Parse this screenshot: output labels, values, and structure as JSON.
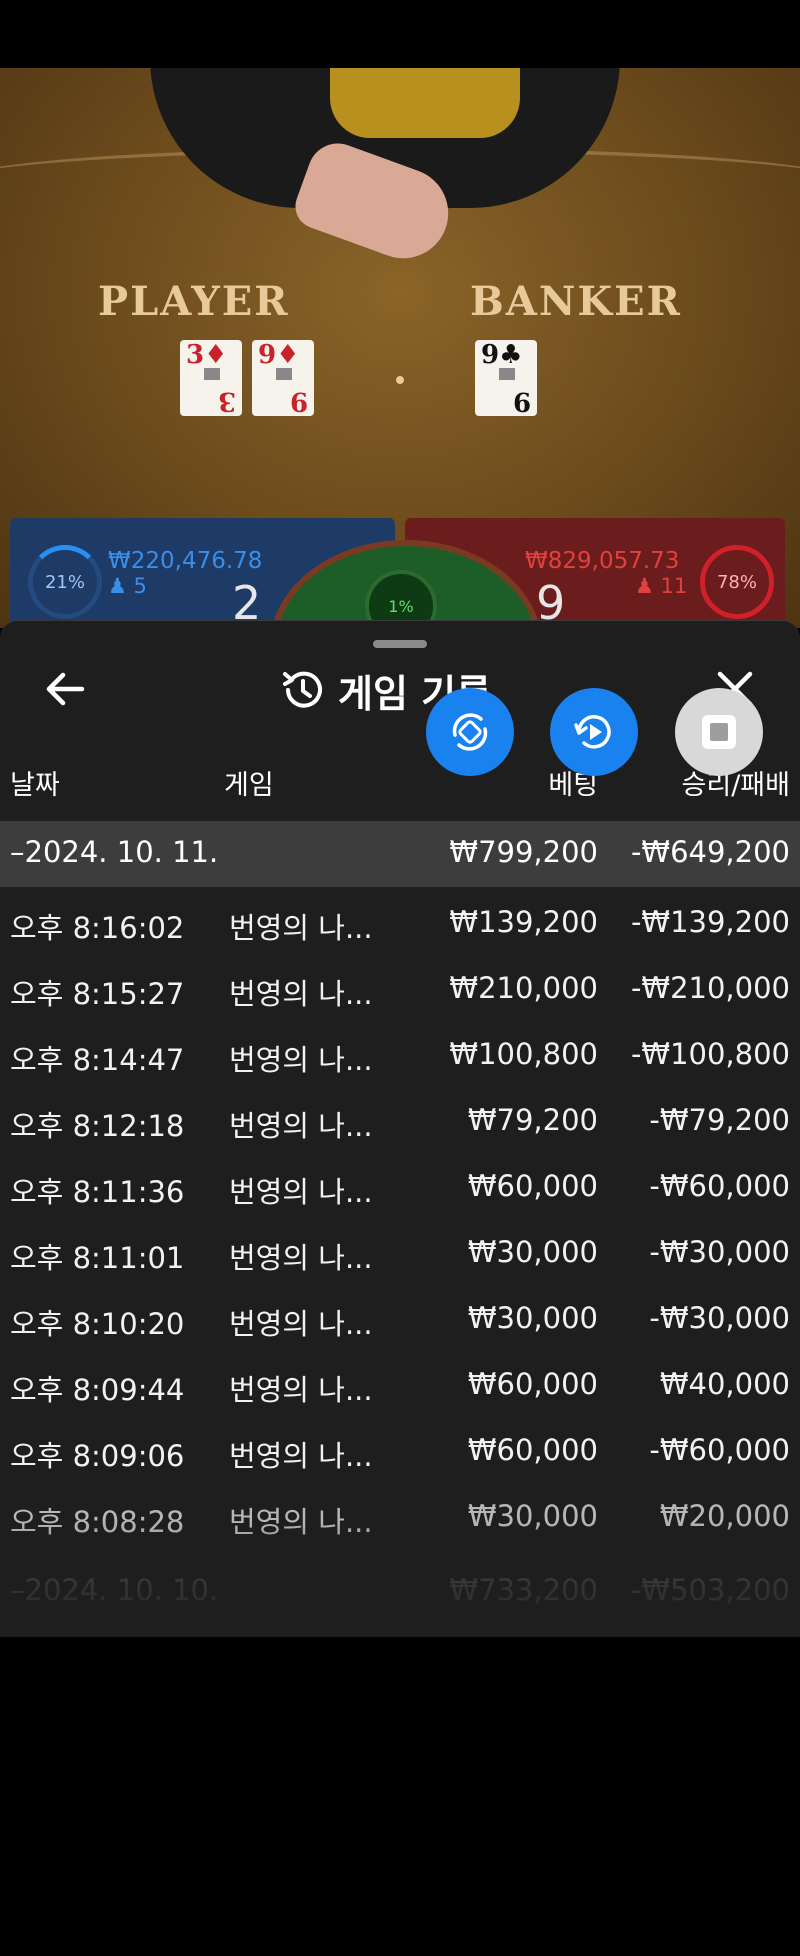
{
  "game_view": {
    "player_label": "PLAYER",
    "banker_label": "BANKER",
    "player_cards": [
      {
        "rank": "3",
        "suit": "♦",
        "color": "#c8222a"
      },
      {
        "rank": "9",
        "suit": "♦",
        "color": "#c8222a"
      }
    ],
    "banker_cards": [
      {
        "rank": "9",
        "suit": "♣",
        "color": "#111111"
      }
    ],
    "player_percent": "21%",
    "player_amount": "₩220,476.78",
    "player_count": "5",
    "player_score": "2",
    "tie_percent": "1%",
    "banker_amount": "₩829,057.73",
    "banker_count": "11",
    "banker_score": "9",
    "banker_percent": "78%"
  },
  "sheet": {
    "title": "게임 기록",
    "title_icon": "history-icon",
    "back_icon": "arrow-left-icon",
    "close_icon": "close-icon",
    "columns": {
      "date": "날짜",
      "game": "게임",
      "bet": "베팅",
      "win_loss": "승리/패배"
    },
    "group": {
      "date": "–2024. 10. 11.",
      "bet": "₩799,200",
      "win_loss": "-₩649,200"
    },
    "rows": [
      {
        "time": "오후 8:16:02",
        "game": "번영의 나...",
        "bet": "₩139,200",
        "win_loss": "-₩139,200"
      },
      {
        "time": "오후 8:15:27",
        "game": "번영의 나...",
        "bet": "₩210,000",
        "win_loss": "-₩210,000"
      },
      {
        "time": "오후 8:14:47",
        "game": "번영의 나...",
        "bet": "₩100,800",
        "win_loss": "-₩100,800"
      },
      {
        "time": "오후 8:12:18",
        "game": "번영의 나...",
        "bet": "₩79,200",
        "win_loss": "-₩79,200"
      },
      {
        "time": "오후 8:11:36",
        "game": "번영의 나...",
        "bet": "₩60,000",
        "win_loss": "-₩60,000"
      },
      {
        "time": "오후 8:11:01",
        "game": "번영의 나...",
        "bet": "₩30,000",
        "win_loss": "-₩30,000"
      },
      {
        "time": "오후 8:10:20",
        "game": "번영의 나...",
        "bet": "₩30,000",
        "win_loss": "-₩30,000"
      },
      {
        "time": "오후 8:09:44",
        "game": "번영의 나...",
        "bet": "₩60,000",
        "win_loss": "₩40,000"
      },
      {
        "time": "오후 8:09:06",
        "game": "번영의 나...",
        "bet": "₩60,000",
        "win_loss": "-₩60,000"
      },
      {
        "time": "오후 8:08:28",
        "game": "번영의 나...",
        "bet": "₩30,000",
        "win_loss": "₩20,000"
      }
    ],
    "next_group": {
      "date": "–2024. 10. 10.",
      "bet": "₩733,200",
      "win_loss": "-₩503,200"
    }
  },
  "floating_buttons": [
    {
      "icon": "rotate-screen-icon",
      "color": "#1a82ee"
    },
    {
      "icon": "replay-video-icon",
      "color": "#1a82ee"
    },
    {
      "icon": "stop-record-icon",
      "color": "#d8d8d8"
    }
  ]
}
